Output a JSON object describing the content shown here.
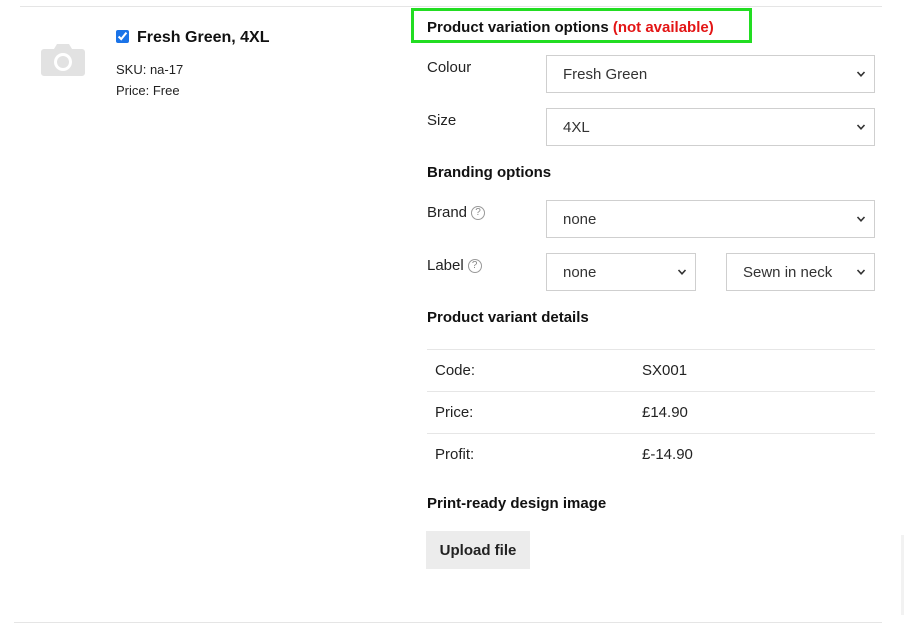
{
  "product": {
    "title": "Fresh Green, 4XL",
    "checked": true,
    "sku": "SKU: na-17",
    "price": "Price: Free"
  },
  "variation": {
    "heading": "Product variation options",
    "status": "(not available)",
    "colour_label": "Colour",
    "colour_value": "Fresh Green",
    "size_label": "Size",
    "size_value": "4XL"
  },
  "branding": {
    "heading": "Branding options",
    "brand_label": "Brand",
    "brand_value": "none",
    "label_label": "Label",
    "label_value": "none",
    "label_position_value": "Sewn in neck"
  },
  "details": {
    "heading": "Product variant details",
    "rows": [
      {
        "key": "Code:",
        "value": "SX001"
      },
      {
        "key": "Price:",
        "value": "£14.90"
      },
      {
        "key": "Profit:",
        "value": "£-14.90"
      }
    ]
  },
  "design": {
    "heading": "Print-ready design image",
    "upload_label": "Upload file"
  },
  "icons": {
    "thumbnail": "camera-icon",
    "help": "help-circle-icon",
    "dropdown": "chevron-down-icon"
  },
  "colors": {
    "highlight": "#22dd22",
    "status_red": "#e31515"
  }
}
